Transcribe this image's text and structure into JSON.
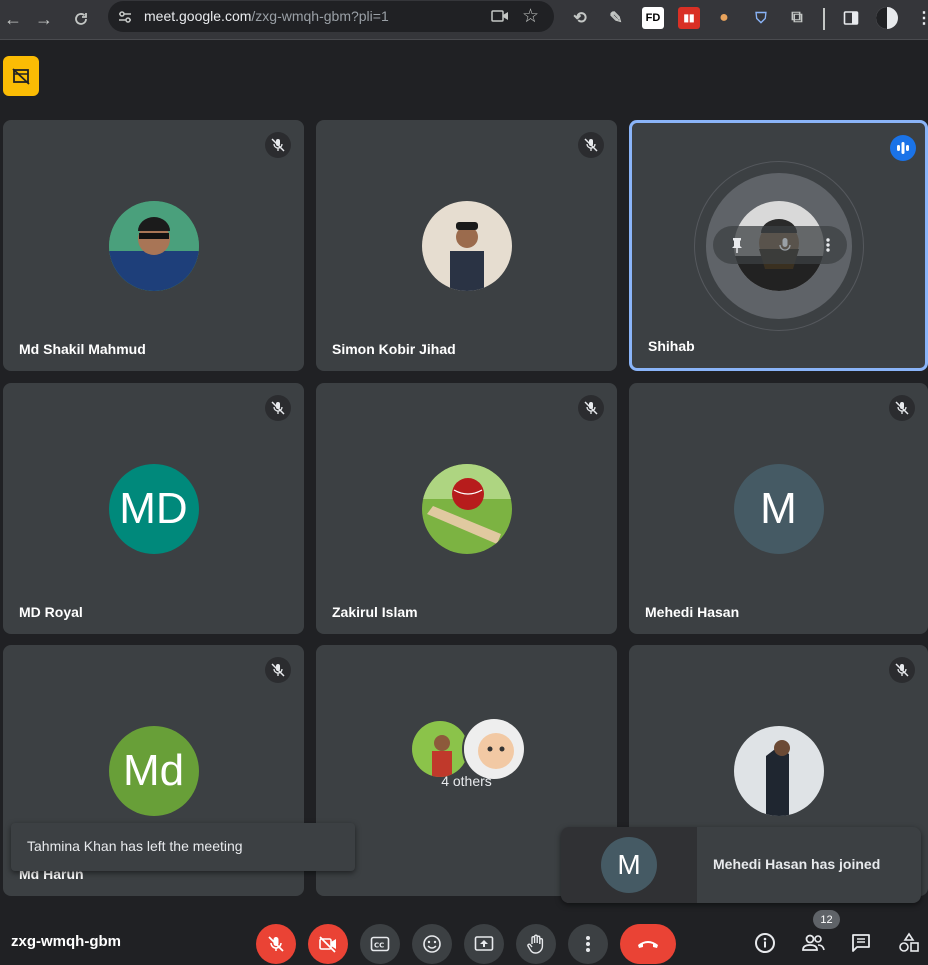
{
  "browser": {
    "url_host": "meet.google.com",
    "url_path": "/zxg-wmqh-gbm?pli=1",
    "ext_fd_label": "FD"
  },
  "meeting": {
    "code": "zxg-wmqh-gbm",
    "participant_count": "12"
  },
  "tiles": [
    {
      "name": "Md Shakil Mahmud",
      "avatar": "photo",
      "muted": true
    },
    {
      "name": "Simon Kobir Jihad",
      "avatar": "photo",
      "muted": true
    },
    {
      "name": "Shihab",
      "avatar": "photo",
      "speaking": true
    },
    {
      "name": "MD Royal",
      "avatar_initials": "MD",
      "avatar_color": "#00897b",
      "muted": true
    },
    {
      "name": "Zakirul Islam",
      "avatar": "photo",
      "muted": true
    },
    {
      "name": "Mehedi Hasan",
      "avatar_initials": "M",
      "avatar_color": "#455a64",
      "muted": true
    },
    {
      "name": "Md Harun",
      "avatar_initials": "Md",
      "avatar_color": "#689f38",
      "muted": true
    },
    {
      "others_label": "4 others"
    },
    {
      "avatar": "photo",
      "muted": true
    }
  ],
  "notifications": {
    "left_toast": "Tahmina Khan has left the meeting",
    "joined_card": "Mehedi Hasan has joined",
    "joined_initial": "M"
  },
  "colors": {
    "accent_red": "#ea4335",
    "speaking_blue": "#8ab4f8",
    "badge_yellow": "#fbbc04"
  }
}
